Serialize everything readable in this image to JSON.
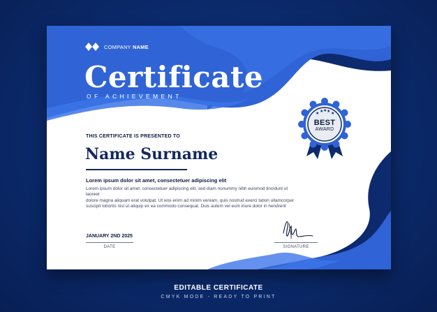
{
  "company": {
    "prefix": "COMPANY",
    "name": "NAME"
  },
  "certificate": {
    "title": "Certificate",
    "subtitle": "OF ACHIEVEMENT",
    "presented_to": "THIS CERTIFICATE IS PRESENTED TO",
    "recipient_name": "Name Surname",
    "lead_line": "Lorem ipsum dolor sit amet, consectetuer adipiscing elit",
    "body_lines": [
      "Lorem ipsum dolor sit amet, consectetuer adipiscing elit, sed diam nonummy nibh euismod tincidunt ut laoreet",
      "dolore magna aliquam erat volutpat. Ut wisi enim ad minim veniam, quis nostrud exerci tation ullamcorper",
      "suscipit lobortis nisl ut aliquip ex ea commodo consequat. Duis autem vel eum iriure dolor in hendrerit"
    ],
    "date_value": "JANUARY 2ND 2025",
    "date_label": "DATE",
    "signature_label": "SIGNATURE"
  },
  "badge": {
    "line1": "BEST",
    "line2": "AWARD",
    "star_count": 5
  },
  "footer": {
    "title": "EDITABLE CERTIFICATE",
    "subtitle": "CMYK MODE - READY TO PRINT"
  },
  "colors": {
    "background": "#0b2a6b",
    "primary_blue": "#2f63d6",
    "dark_navy": "#0e2a6e",
    "text_dark": "#0d1b3d"
  }
}
